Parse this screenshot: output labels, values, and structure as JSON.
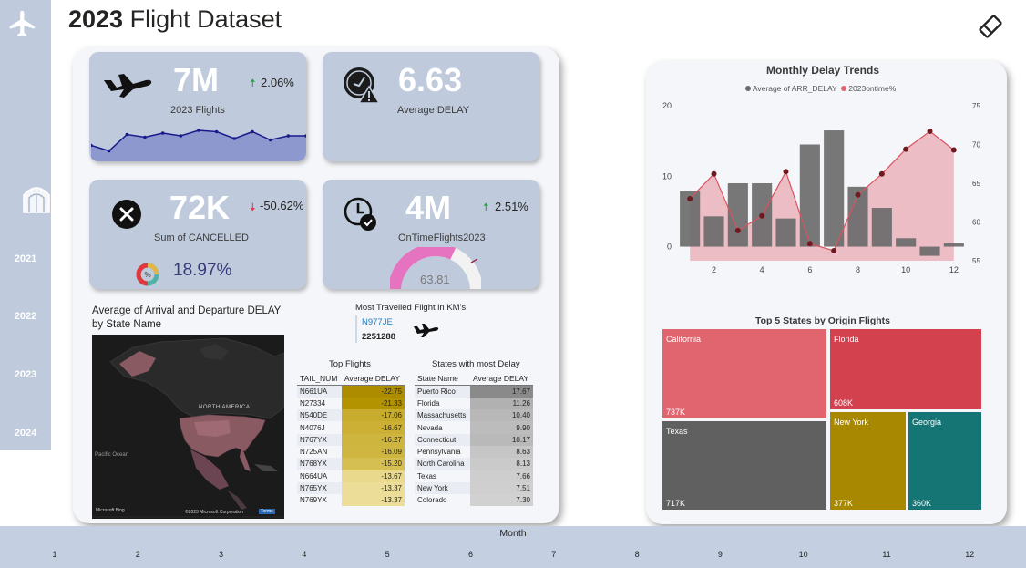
{
  "header": {
    "title_year": "2023",
    "title_rest": " Flight Dataset"
  },
  "sidebar": {
    "years": [
      "2021",
      "2022",
      "2023",
      "2024"
    ]
  },
  "kpi": {
    "flights": {
      "value": "7M",
      "label": "2023 Flights",
      "change": "2.06%",
      "sparkline": [
        0.45,
        0.25,
        0.85,
        0.75,
        0.9,
        0.8,
        1.0,
        0.95,
        0.7,
        0.95,
        0.65,
        0.8,
        0.8
      ]
    },
    "delay": {
      "value": "6.63",
      "label": "Average DELAY"
    },
    "cancelled": {
      "value": "72K",
      "label": "Sum of CANCELLED",
      "change": "-50.62%",
      "rate": "18.97%"
    },
    "ontime": {
      "value": "4M",
      "label": "OnTimeFlights2023",
      "change": "2.51%",
      "gauge_value": "63.81",
      "gauge_fill": 0.64
    }
  },
  "map": {
    "title_line1": "Average of Arrival and Departure DELAY",
    "title_line2": "by State Name",
    "label_na": "NORTH AMERICA",
    "label_pacific": "Pacific Ocean",
    "attribution_left": "Microsoft Bing",
    "attribution_right": "©2023 Microsoft Corporation",
    "attribution_terms": "Terms"
  },
  "most_travelled": {
    "title": "Most Travelled Flight in KM's",
    "tail": "N977JE",
    "distance": "2251288"
  },
  "top_flights": {
    "title": "Top Flights",
    "headers": [
      "TAIL_NUM",
      "Average DELAY"
    ],
    "rows": [
      [
        "N661UA",
        "-22.75",
        "#ad8c00"
      ],
      [
        "N27334",
        "-21.33",
        "#b49300"
      ],
      [
        "N540DE",
        "-17.06",
        "#c8ac2e"
      ],
      [
        "N4076J",
        "-16.67",
        "#cbb035"
      ],
      [
        "N767YX",
        "-16.27",
        "#ceb53d"
      ],
      [
        "N725AN",
        "-16.09",
        "#cfb640"
      ],
      [
        "N768YX",
        "-15.20",
        "#d6bf52"
      ],
      [
        "N664UA",
        "-13.67",
        "#e8d98d"
      ],
      [
        "N765YX",
        "-13.37",
        "#ecdd98"
      ],
      [
        "N769YX",
        "-13.37",
        "#ecdd98"
      ]
    ]
  },
  "states_delay": {
    "title": "States with most Delay",
    "headers": [
      "State Name",
      "Average DELAY"
    ],
    "rows": [
      [
        "Puerto Rico",
        "17.67",
        "#8a8a8a"
      ],
      [
        "Florida",
        "11.26",
        "#b1b1b1"
      ],
      [
        "Massachusetts",
        "10.40",
        "#b8b8b8"
      ],
      [
        "Nevada",
        "9.90",
        "#bcbcbc"
      ],
      [
        "Connecticut",
        "10.17",
        "#b9b9b9"
      ],
      [
        "Pennsylvania",
        "8.63",
        "#c6c6c6"
      ],
      [
        "North Carolina",
        "8.13",
        "#cacaca"
      ],
      [
        "Texas",
        "7.66",
        "#cecece"
      ],
      [
        "New York",
        "7.51",
        "#cfcfcf"
      ],
      [
        "Colorado",
        "7.30",
        "#d1d1d1"
      ]
    ]
  },
  "chart_data": [
    {
      "type": "bar",
      "title": "Monthly Delay Trends",
      "legend_position": "top-center",
      "x": [
        1,
        2,
        3,
        4,
        5,
        6,
        7,
        8,
        9,
        10,
        11,
        12
      ],
      "x_ticks": [
        "2",
        "4",
        "6",
        "8",
        "10",
        "12"
      ],
      "y_ticks": [
        "20",
        "10",
        "0"
      ],
      "y2_ticks": [
        "75",
        "70",
        "65",
        "60",
        "55"
      ],
      "ylim": [
        -2,
        20
      ],
      "y2lim": [
        55,
        75
      ],
      "series": [
        {
          "name": "Average of ARR_DELAY",
          "kind": "bar",
          "axis": "left",
          "color": "#6b6b6b",
          "values": [
            7.9,
            4.3,
            9.0,
            9.0,
            4.0,
            14.5,
            16.5,
            8.5,
            5.5,
            1.2,
            -1.3,
            0.5
          ]
        },
        {
          "name": "2023ontime%",
          "kind": "area",
          "axis": "right",
          "color": "#e0656f",
          "values": [
            63.0,
            66.2,
            58.9,
            60.8,
            66.5,
            57.2,
            56.3,
            63.5,
            66.2,
            69.4,
            71.7,
            69.3
          ]
        }
      ]
    },
    {
      "type": "treemap",
      "title": "Top 5 States by Origin Flights",
      "categories": [
        "California",
        "Florida",
        "Texas",
        "New York",
        "Georgia"
      ],
      "labels": [
        "737K",
        "608K",
        "717K",
        "377K",
        "360K"
      ],
      "values": [
        737,
        608,
        717,
        377,
        360
      ],
      "colors": [
        "#e0656f",
        "#d4414e",
        "#606060",
        "#a88800",
        "#157575"
      ]
    }
  ],
  "slicer": {
    "title": "Month",
    "months": [
      "1",
      "2",
      "3",
      "4",
      "5",
      "6",
      "7",
      "8",
      "9",
      "10",
      "11",
      "12"
    ]
  },
  "colors": {
    "sidebar": "#bfcbdc",
    "card": "#bfcbdc",
    "up": "#2ea043",
    "down": "#e0383e",
    "gauge": "#e673c0"
  },
  "icons": [
    "airplane-icon",
    "hangar-icon",
    "eraser-icon",
    "plane-kpi-icon",
    "delay-clock-icon",
    "cancel-icon",
    "percent-donut-icon",
    "ontime-clock-icon",
    "plane-small-icon"
  ]
}
